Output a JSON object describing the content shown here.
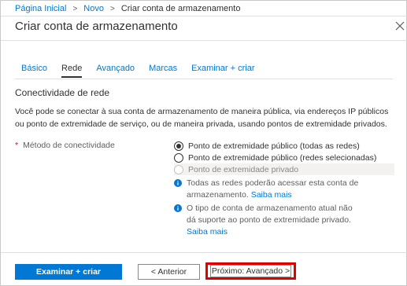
{
  "breadcrumb": {
    "home": "Página Inicial",
    "new": "Novo",
    "current": "Criar conta de armazenamento",
    "separator": ">"
  },
  "page": {
    "title": "Criar conta de armazenamento",
    "close_icon": "close-icon"
  },
  "tabs": [
    {
      "label": "Básico",
      "active": false
    },
    {
      "label": "Rede",
      "active": true
    },
    {
      "label": "Avançado",
      "active": false
    },
    {
      "label": "Marcas",
      "active": false
    },
    {
      "label": "Examinar + criar",
      "active": false
    }
  ],
  "section": {
    "title": "Conectividade de rede",
    "description": "Você pode se conectar à sua conta de armazenamento de maneira pública, via endereços IP públicos ou ponto de extremidade de serviço, ou de maneira privada, usando pontos de extremidade privados."
  },
  "connectivity": {
    "required_marker": "*",
    "label": "Método de conectividade",
    "options": [
      {
        "label": "Ponto de extremidade público (todas as redes)",
        "selected": true,
        "disabled": false
      },
      {
        "label": "Ponto de extremidade público (redes selecionadas)",
        "selected": false,
        "disabled": false
      },
      {
        "label": "Ponto de extremidade privado",
        "selected": false,
        "disabled": true
      }
    ],
    "info1": {
      "text": "Todas as redes poderão acessar esta conta de armazenamento.",
      "link": "Saiba mais"
    },
    "info2": {
      "text": "O tipo de conta de armazenamento atual não dá suporte ao ponto de extremidade privado.",
      "link": "Saiba mais"
    }
  },
  "footer": {
    "review_create": "Examinar + criar",
    "previous": "< Anterior",
    "next": "Próximo: Avançado >"
  },
  "colors": {
    "accent": "#0078d4",
    "highlight": "#e00000",
    "required": "#a4262c"
  }
}
